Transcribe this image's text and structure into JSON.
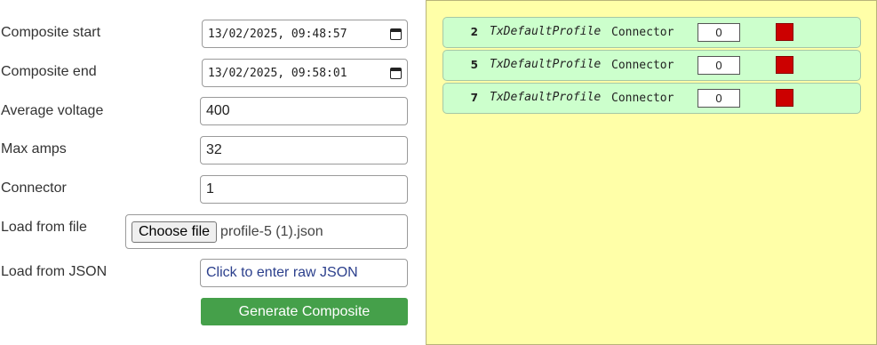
{
  "form": {
    "composite_start": {
      "label": "Composite start",
      "value": "13/02/2025, 09:48:57"
    },
    "composite_end": {
      "label": "Composite end",
      "value": "13/02/2025, 09:58:01"
    },
    "average_voltage": {
      "label": "Average voltage",
      "value": "400"
    },
    "max_amps": {
      "label": "Max amps",
      "value": "32"
    },
    "connector": {
      "label": "Connector",
      "value": "1"
    },
    "load_file": {
      "label": "Load from file",
      "button": "Choose file",
      "filename": "profile-5 (1).json"
    },
    "load_json": {
      "label": "Load from JSON",
      "placeholder": "Click to enter raw JSON"
    },
    "generate_button": "Generate Composite"
  },
  "profiles": [
    {
      "id": "2",
      "name": "TxDefaultProfile",
      "purpose": "Connector",
      "stack_level": "0"
    },
    {
      "id": "5",
      "name": "TxDefaultProfile",
      "purpose": "Connector",
      "stack_level": "0"
    },
    {
      "id": "7",
      "name": "TxDefaultProfile",
      "purpose": "Connector",
      "stack_level": "0"
    }
  ],
  "colors": {
    "panel_bg": "#ffffa8",
    "row_bg": "#ccffcc",
    "delete_red": "#cc0000",
    "generate_green": "#45a04a"
  }
}
